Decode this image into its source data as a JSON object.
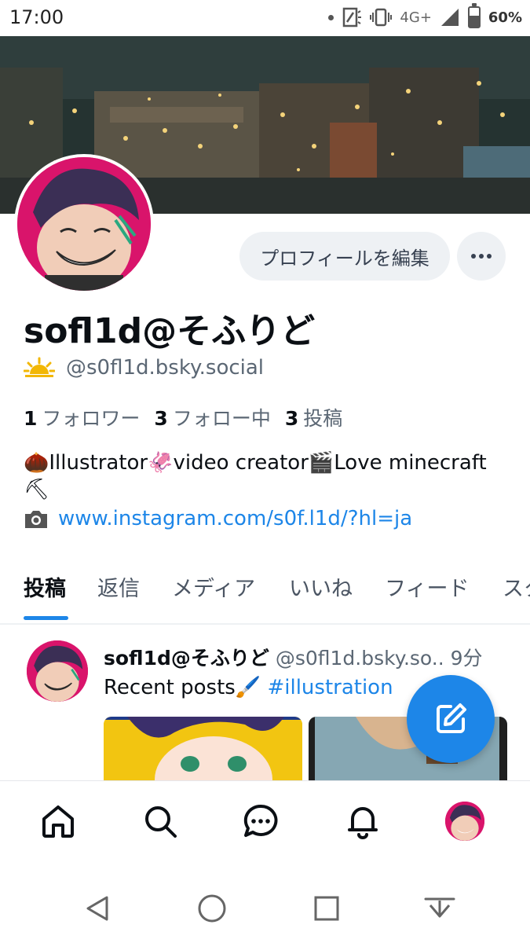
{
  "status_bar": {
    "time": "17:00",
    "network": "4G+",
    "battery": "60%",
    "battery_level": 0.6,
    "icons": [
      "notification-dot-icon",
      "nfc-icon",
      "vibrate-icon",
      "signal-icon",
      "battery-icon"
    ]
  },
  "profile": {
    "edit_label": "プロフィールを編集",
    "display_name": "sofl1d@そふりど",
    "handle": "@s0fl1d.bsky.social",
    "stats": [
      {
        "count": "1",
        "label": "フォロワー"
      },
      {
        "count": "3",
        "label": "フォロー中"
      },
      {
        "count": "3",
        "label": "投稿"
      }
    ],
    "bio_text": "🌰Illustrator🦑video creator🎬Love minecraft⛏",
    "bio_link": "www.instagram.com/s0f.l1d/?hl=ja"
  },
  "tabs": [
    {
      "label": "投稿",
      "active": true
    },
    {
      "label": "返信",
      "active": false
    },
    {
      "label": "メディア",
      "active": false
    },
    {
      "label": "いいね",
      "active": false
    },
    {
      "label": "フィード",
      "active": false
    },
    {
      "label": "スタ",
      "active": false
    }
  ],
  "post": {
    "author_name": "sofl1d@そふりど",
    "author_handle": "@s0fl1d.bsky.so..",
    "time": "9分",
    "text": "Recent posts🖌️",
    "hashtag": "#illustration"
  },
  "colors": {
    "accent": "#1d86e8",
    "button_bg": "#eef1f4",
    "muted_text": "#5b6774"
  }
}
